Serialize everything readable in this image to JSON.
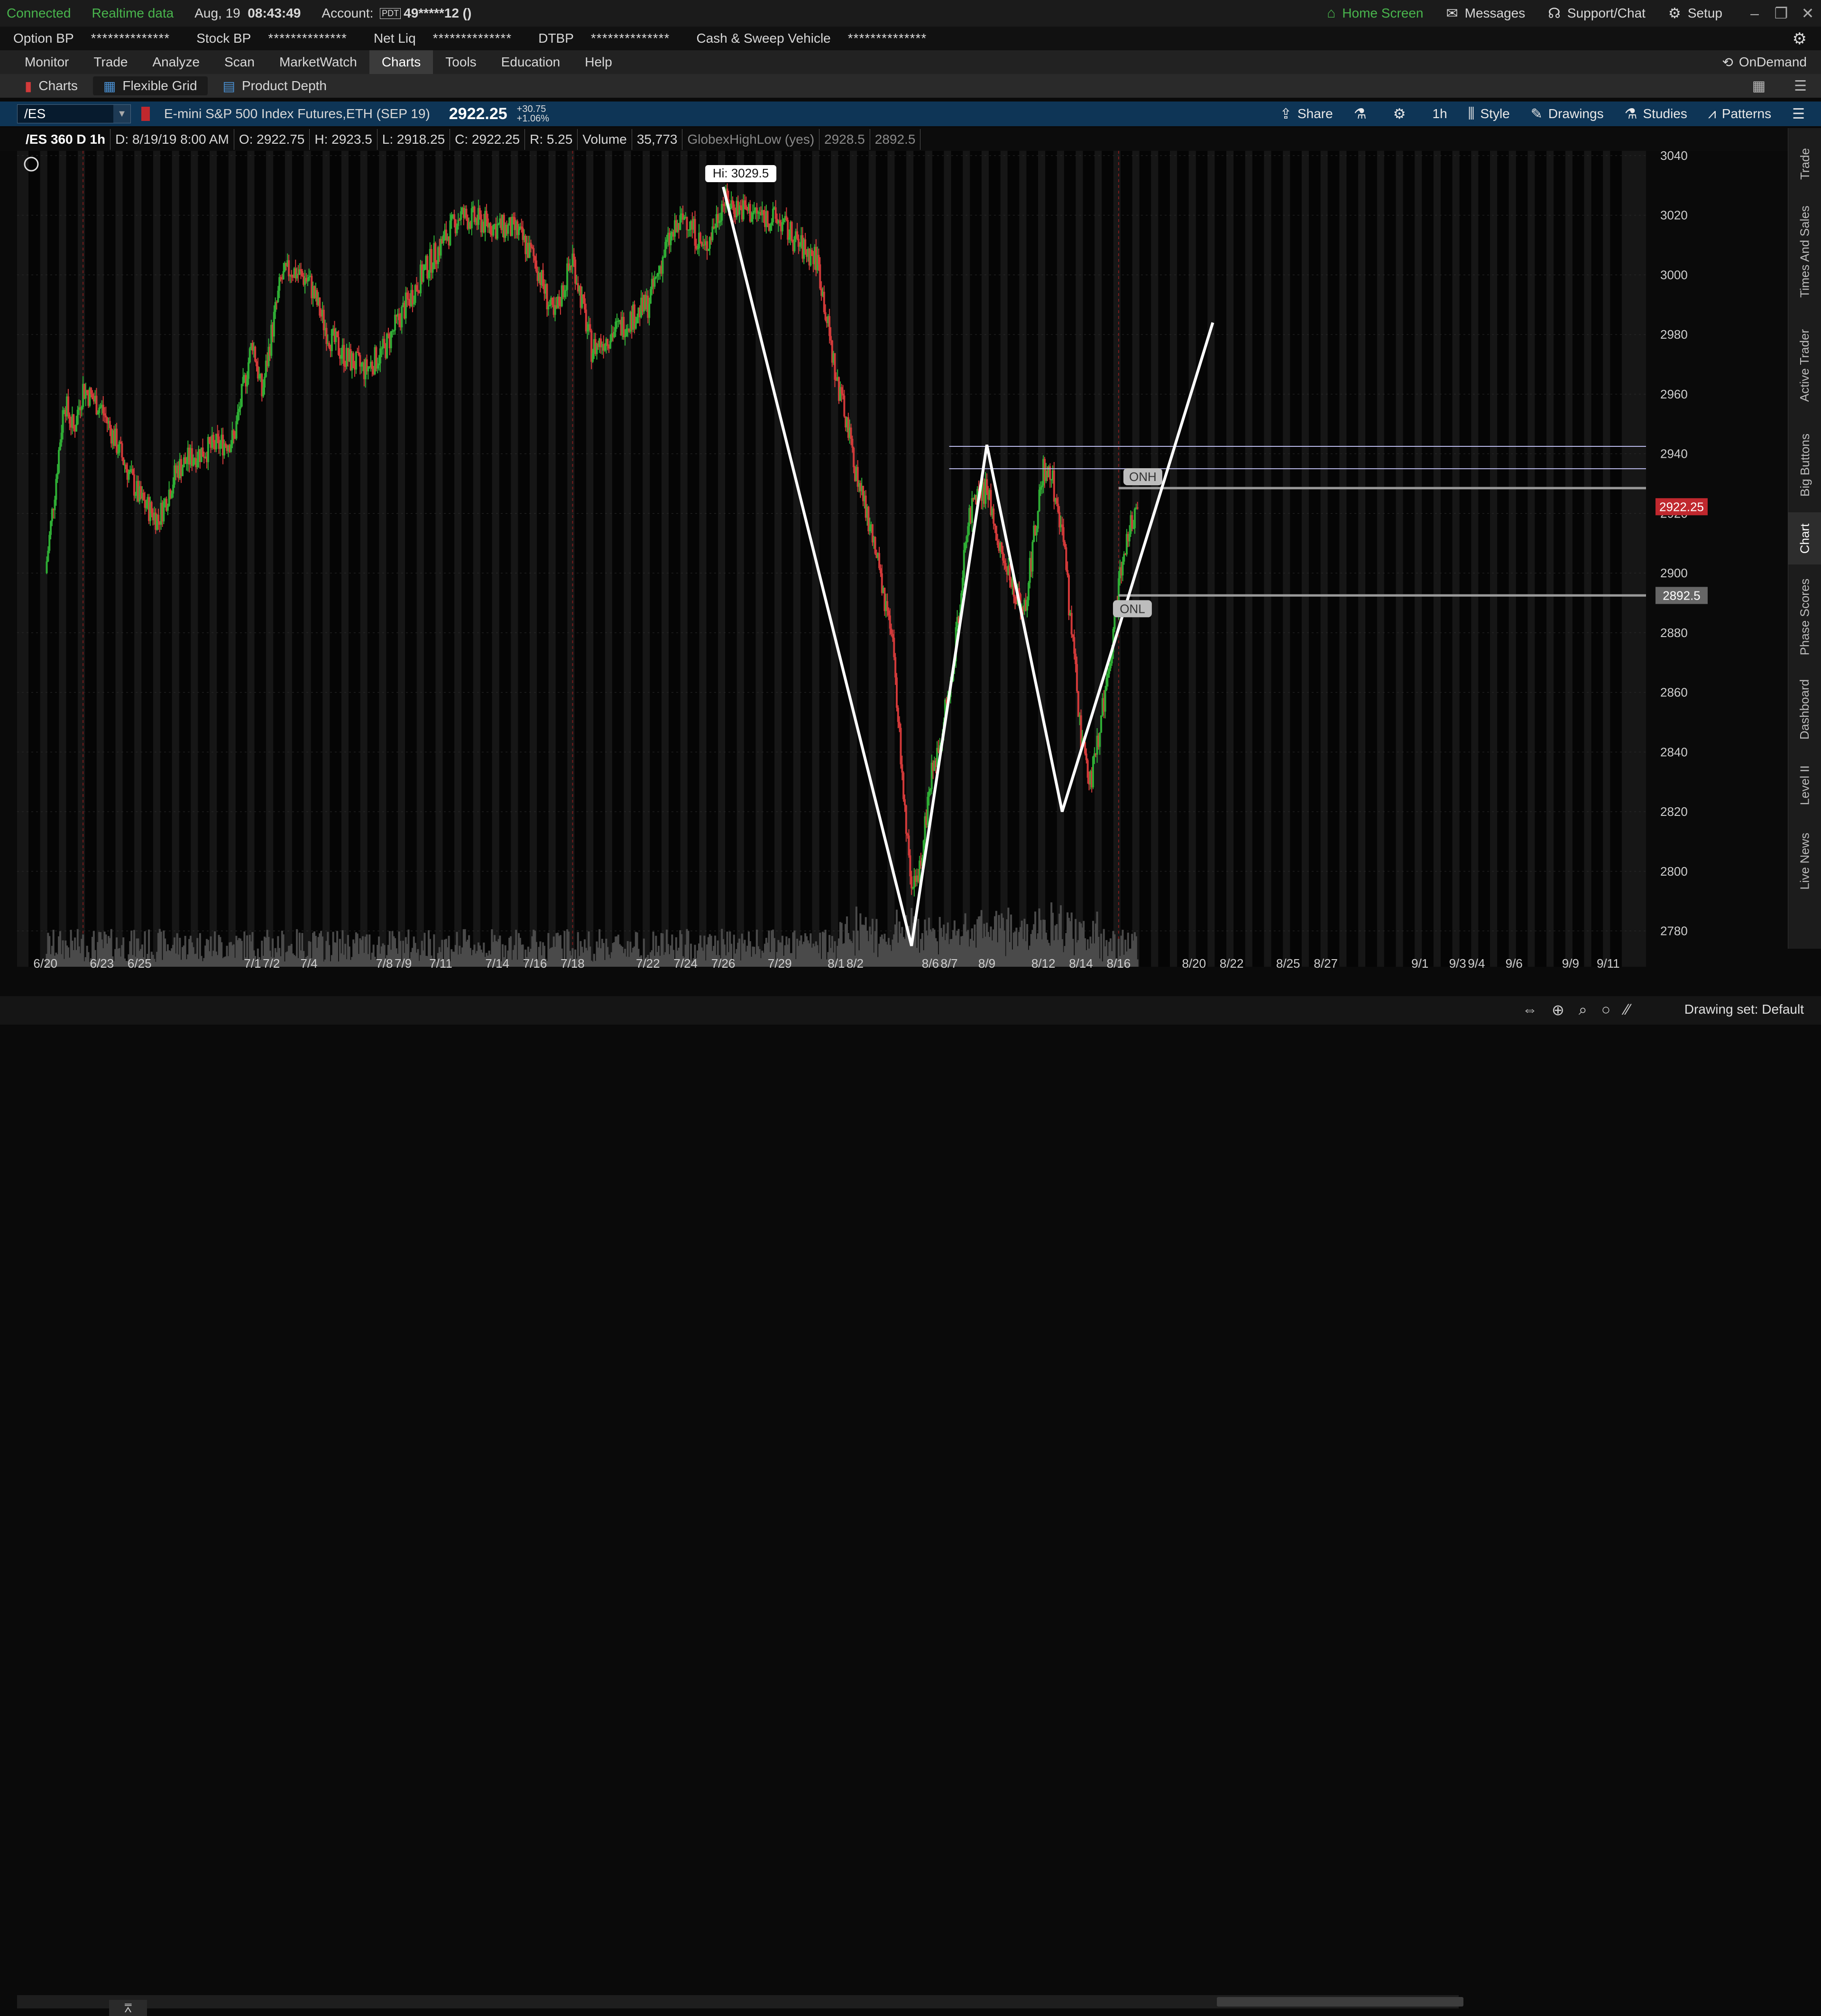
{
  "status": {
    "connected": "Connected",
    "realtime": "Realtime data",
    "date": "Aug, 19",
    "time": "08:43:49",
    "account_label": "Account:",
    "account_badge": "PDT",
    "account_value": "49*****12 ()",
    "home_screen": "Home Screen",
    "messages": "Messages",
    "support": "Support/Chat",
    "setup": "Setup"
  },
  "accountbar": {
    "items": [
      {
        "label": "Option BP",
        "value": "**************"
      },
      {
        "label": "Stock BP",
        "value": "**************"
      },
      {
        "label": "Net Liq",
        "value": "**************"
      },
      {
        "label": "DTBP",
        "value": "**************"
      },
      {
        "label": "Cash & Sweep Vehicle",
        "value": "**************"
      }
    ]
  },
  "menu": {
    "items": [
      "Monitor",
      "Trade",
      "Analyze",
      "Scan",
      "MarketWatch",
      "Charts",
      "Tools",
      "Education",
      "Help"
    ],
    "active": "Charts",
    "ondemand": "OnDemand"
  },
  "subtabs": {
    "items": [
      "Charts",
      "Flexible Grid",
      "Product Depth"
    ]
  },
  "symbol": {
    "ticker": "/ES",
    "description": "E-mini S&P 500 Index Futures,ETH (SEP 19)",
    "last": "2922.25",
    "change": "+30.75",
    "change_pct": "+1.06%"
  },
  "toolbar": {
    "share": "Share",
    "timeframe": "1h",
    "style": "Style",
    "drawings": "Drawings",
    "studies": "Studies",
    "patterns": "Patterns"
  },
  "databar": {
    "title": "/ES 360 D 1h",
    "date": "D: 8/19/19 8:00 AM",
    "open": "O: 2922.75",
    "high": "H: 2923.5",
    "low": "L: 2918.25",
    "close": "C: 2922.25",
    "range": "R: 5.25",
    "volume_label": "Volume",
    "volume": "35,773",
    "study": "GlobexHighLow (yes)",
    "study_high": "2928.5",
    "study_low": "2892.5"
  },
  "chart_data": {
    "type": "candlestick",
    "symbol": "/ES",
    "interval": "1h",
    "x_ticks": [
      "6/20",
      "6/23",
      "6/25",
      "7/1",
      "7/2",
      "7/4",
      "7/8",
      "7/9",
      "7/11",
      "7/14",
      "7/16",
      "7/18",
      "7/22",
      "7/24",
      "7/26",
      "7/29",
      "8/1",
      "8/2",
      "8/6",
      "8/7",
      "8/9",
      "8/12",
      "8/14",
      "8/16",
      "8/20",
      "8/22",
      "8/25",
      "8/27",
      "9/1",
      "9/3",
      "9/4",
      "9/6",
      "9/9",
      "9/11"
    ],
    "y_ticks": [
      2780,
      2800,
      2820,
      2840,
      2860,
      2880,
      2900,
      2920,
      2940,
      2960,
      2980,
      3000,
      3020,
      3040
    ],
    "ylim": [
      2768,
      3040
    ],
    "price_path": [
      [
        "6/20",
        2900
      ],
      [
        "6/20",
        2928
      ],
      [
        "6/21",
        2958
      ],
      [
        "6/21",
        2948
      ],
      [
        "6/22",
        2962
      ],
      [
        "6/23",
        2955
      ],
      [
        "6/24",
        2940
      ],
      [
        "6/25",
        2925
      ],
      [
        "6/26",
        2918
      ],
      [
        "6/27",
        2935
      ],
      [
        "6/28",
        2940
      ],
      [
        "6/30",
        2945
      ],
      [
        "7/1",
        2978
      ],
      [
        "7/1",
        2960
      ],
      [
        "7/2",
        2980
      ],
      [
        "7/2",
        2998
      ],
      [
        "7/3",
        3002
      ],
      [
        "7/4",
        2998
      ],
      [
        "7/5",
        2980
      ],
      [
        "7/6",
        2972
      ],
      [
        "7/7",
        2968
      ],
      [
        "7/8",
        2975
      ],
      [
        "7/9",
        2988
      ],
      [
        "7/10",
        3000
      ],
      [
        "7/11",
        3010
      ],
      [
        "7/12",
        3020
      ],
      [
        "7/13",
        3018
      ],
      [
        "7/14",
        3016
      ],
      [
        "7/15",
        3015
      ],
      [
        "7/16",
        3005
      ],
      [
        "7/17",
        2985
      ],
      [
        "7/18",
        3006
      ],
      [
        "7/19",
        2975
      ],
      [
        "7/20",
        2980
      ],
      [
        "7/21",
        2985
      ],
      [
        "7/22",
        2990
      ],
      [
        "7/23",
        3010
      ],
      [
        "7/24",
        3020
      ],
      [
        "7/25",
        3008
      ],
      [
        "7/26",
        3025
      ],
      [
        "7/27",
        3022
      ],
      [
        "7/28",
        3020
      ],
      [
        "7/29",
        3018
      ],
      [
        "7/30",
        3010
      ],
      [
        "7/31",
        3005
      ],
      [
        "8/1",
        2965
      ],
      [
        "8/1",
        2952
      ],
      [
        "8/2",
        2935
      ],
      [
        "8/3",
        2910
      ],
      [
        "8/4",
        2875
      ],
      [
        "8/5",
        2790
      ],
      [
        "8/5",
        2805
      ],
      [
        "8/6",
        2830
      ],
      [
        "8/6",
        2845
      ],
      [
        "8/7",
        2860
      ],
      [
        "8/7",
        2885
      ],
      [
        "8/8",
        2920
      ],
      [
        "8/9",
        2928
      ],
      [
        "8/9",
        2915
      ],
      [
        "8/10",
        2900
      ],
      [
        "8/11",
        2888
      ],
      [
        "8/12",
        2935
      ],
      [
        "8/12",
        2930
      ],
      [
        "8/13",
        2915
      ],
      [
        "8/13",
        2880
      ],
      [
        "8/14",
        2845
      ],
      [
        "8/14",
        2830
      ],
      [
        "8/15",
        2848
      ],
      [
        "8/15",
        2870
      ],
      [
        "8/16",
        2895
      ],
      [
        "8/16",
        2915
      ],
      [
        "8/17",
        2922.25
      ]
    ],
    "high_label": "Hi: 3029.5",
    "last_price": 2922.25,
    "levels": [
      {
        "name": "ONH",
        "value": 2928.5
      },
      {
        "name": "ONL",
        "value": 2892.5
      },
      {
        "name": "",
        "value": 2942.5
      },
      {
        "name": "",
        "value": 2935
      }
    ],
    "price_tags": [
      {
        "value": 2922.25,
        "label": "2922.25",
        "color": "#c0282e"
      },
      {
        "value": 2892.5,
        "label": "2892.5",
        "color": "#666666"
      }
    ],
    "drawing_path": [
      [
        "7/26",
        3029.5
      ],
      [
        "8/5",
        2775
      ],
      [
        "8/9",
        2943
      ],
      [
        "8/13",
        2820
      ],
      [
        "8/21",
        2984
      ]
    ],
    "colors": {
      "up": "#2fae35",
      "down": "#d23a3a",
      "grid": "#2c2c2c",
      "drawing": "#ffffff"
    }
  },
  "rightpanel": {
    "tabs": [
      "Trade",
      "Times And Sales",
      "Active Trader",
      "Big Buttons",
      "Chart",
      "Phase Scores",
      "Dashboard",
      "Level II",
      "Live News"
    ],
    "active": "Chart"
  },
  "bottom": {
    "drawing_set": "Drawing set: Default"
  }
}
